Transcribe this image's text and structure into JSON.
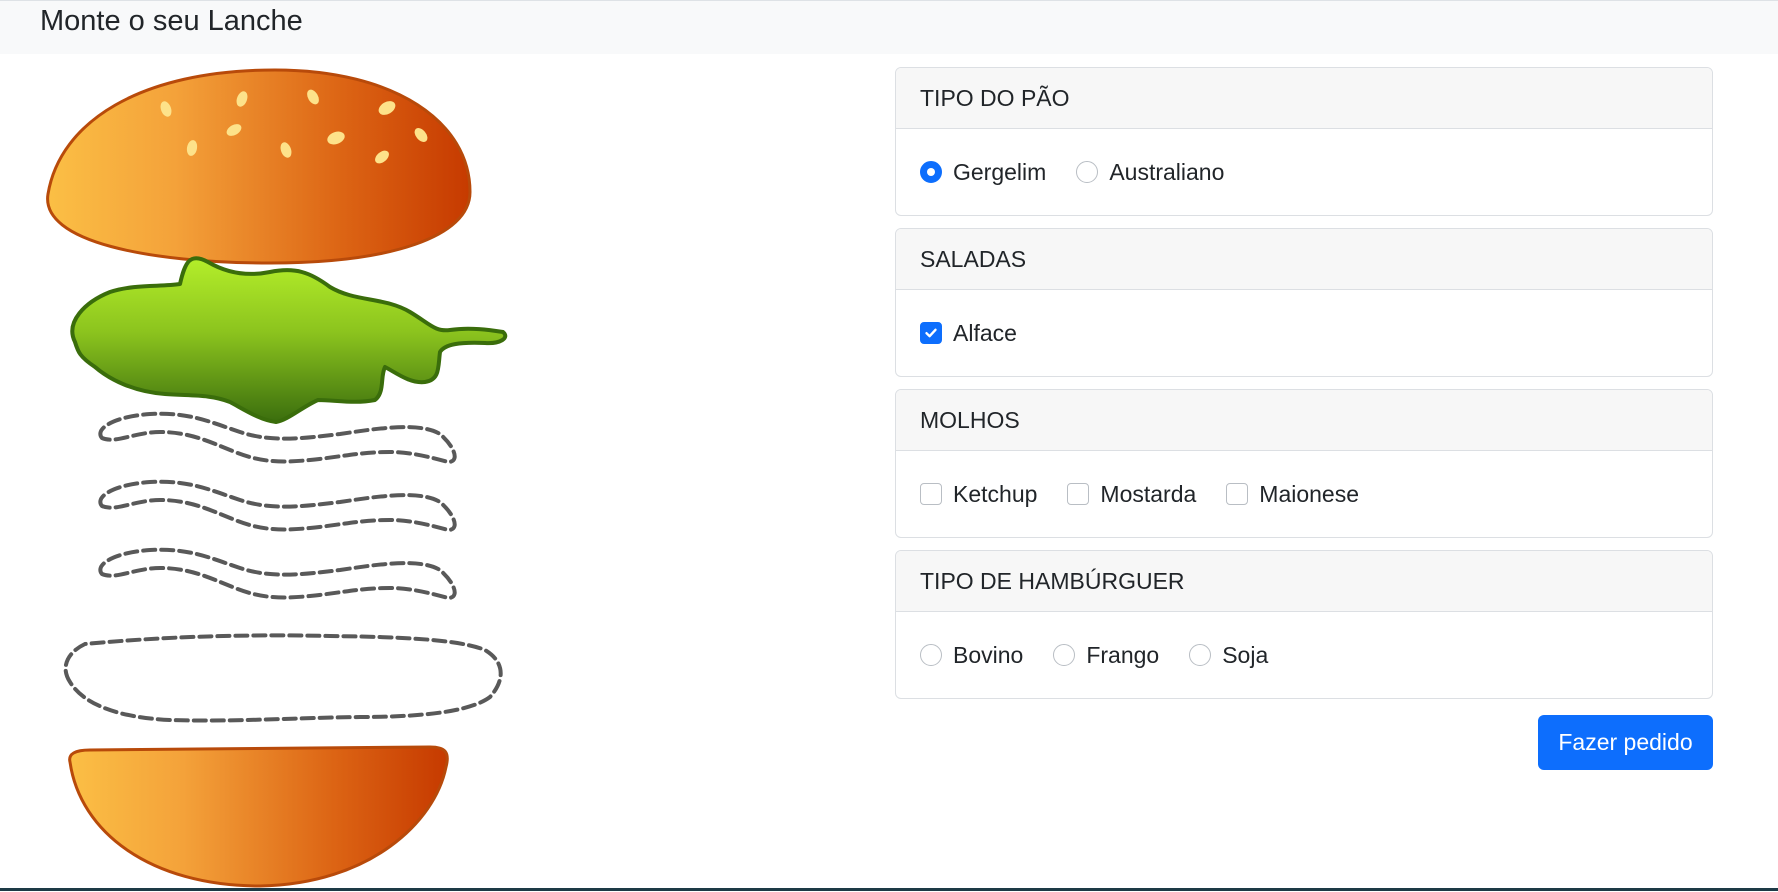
{
  "header": {
    "title": "Monte o seu Lanche"
  },
  "colors": {
    "accent": "#0d6efd",
    "bun_light": "#fbbf45",
    "bun_dark": "#c63a00",
    "lettuce_light": "#b4ee2a",
    "lettuce_dark": "#3b6e0e"
  },
  "burger": {
    "layers": [
      "top-bun",
      "lettuce",
      "sauce-placeholder",
      "sauce-placeholder",
      "sauce-placeholder",
      "patty-placeholder",
      "bottom-bun"
    ]
  },
  "sections": {
    "bread": {
      "title": "TIPO DO PÃO",
      "options": [
        {
          "label": "Gergelim",
          "checked": true
        },
        {
          "label": "Australiano",
          "checked": false
        }
      ]
    },
    "salads": {
      "title": "SALADAS",
      "options": [
        {
          "label": "Alface",
          "checked": true
        }
      ]
    },
    "sauces": {
      "title": "MOLHOS",
      "options": [
        {
          "label": "Ketchup",
          "checked": false
        },
        {
          "label": "Mostarda",
          "checked": false
        },
        {
          "label": "Maionese",
          "checked": false
        }
      ]
    },
    "burger_type": {
      "title": "TIPO DE HAMBÚRGUER",
      "options": [
        {
          "label": "Bovino",
          "checked": false
        },
        {
          "label": "Frango",
          "checked": false
        },
        {
          "label": "Soja",
          "checked": false
        }
      ]
    }
  },
  "actions": {
    "submit_label": "Fazer pedido"
  }
}
